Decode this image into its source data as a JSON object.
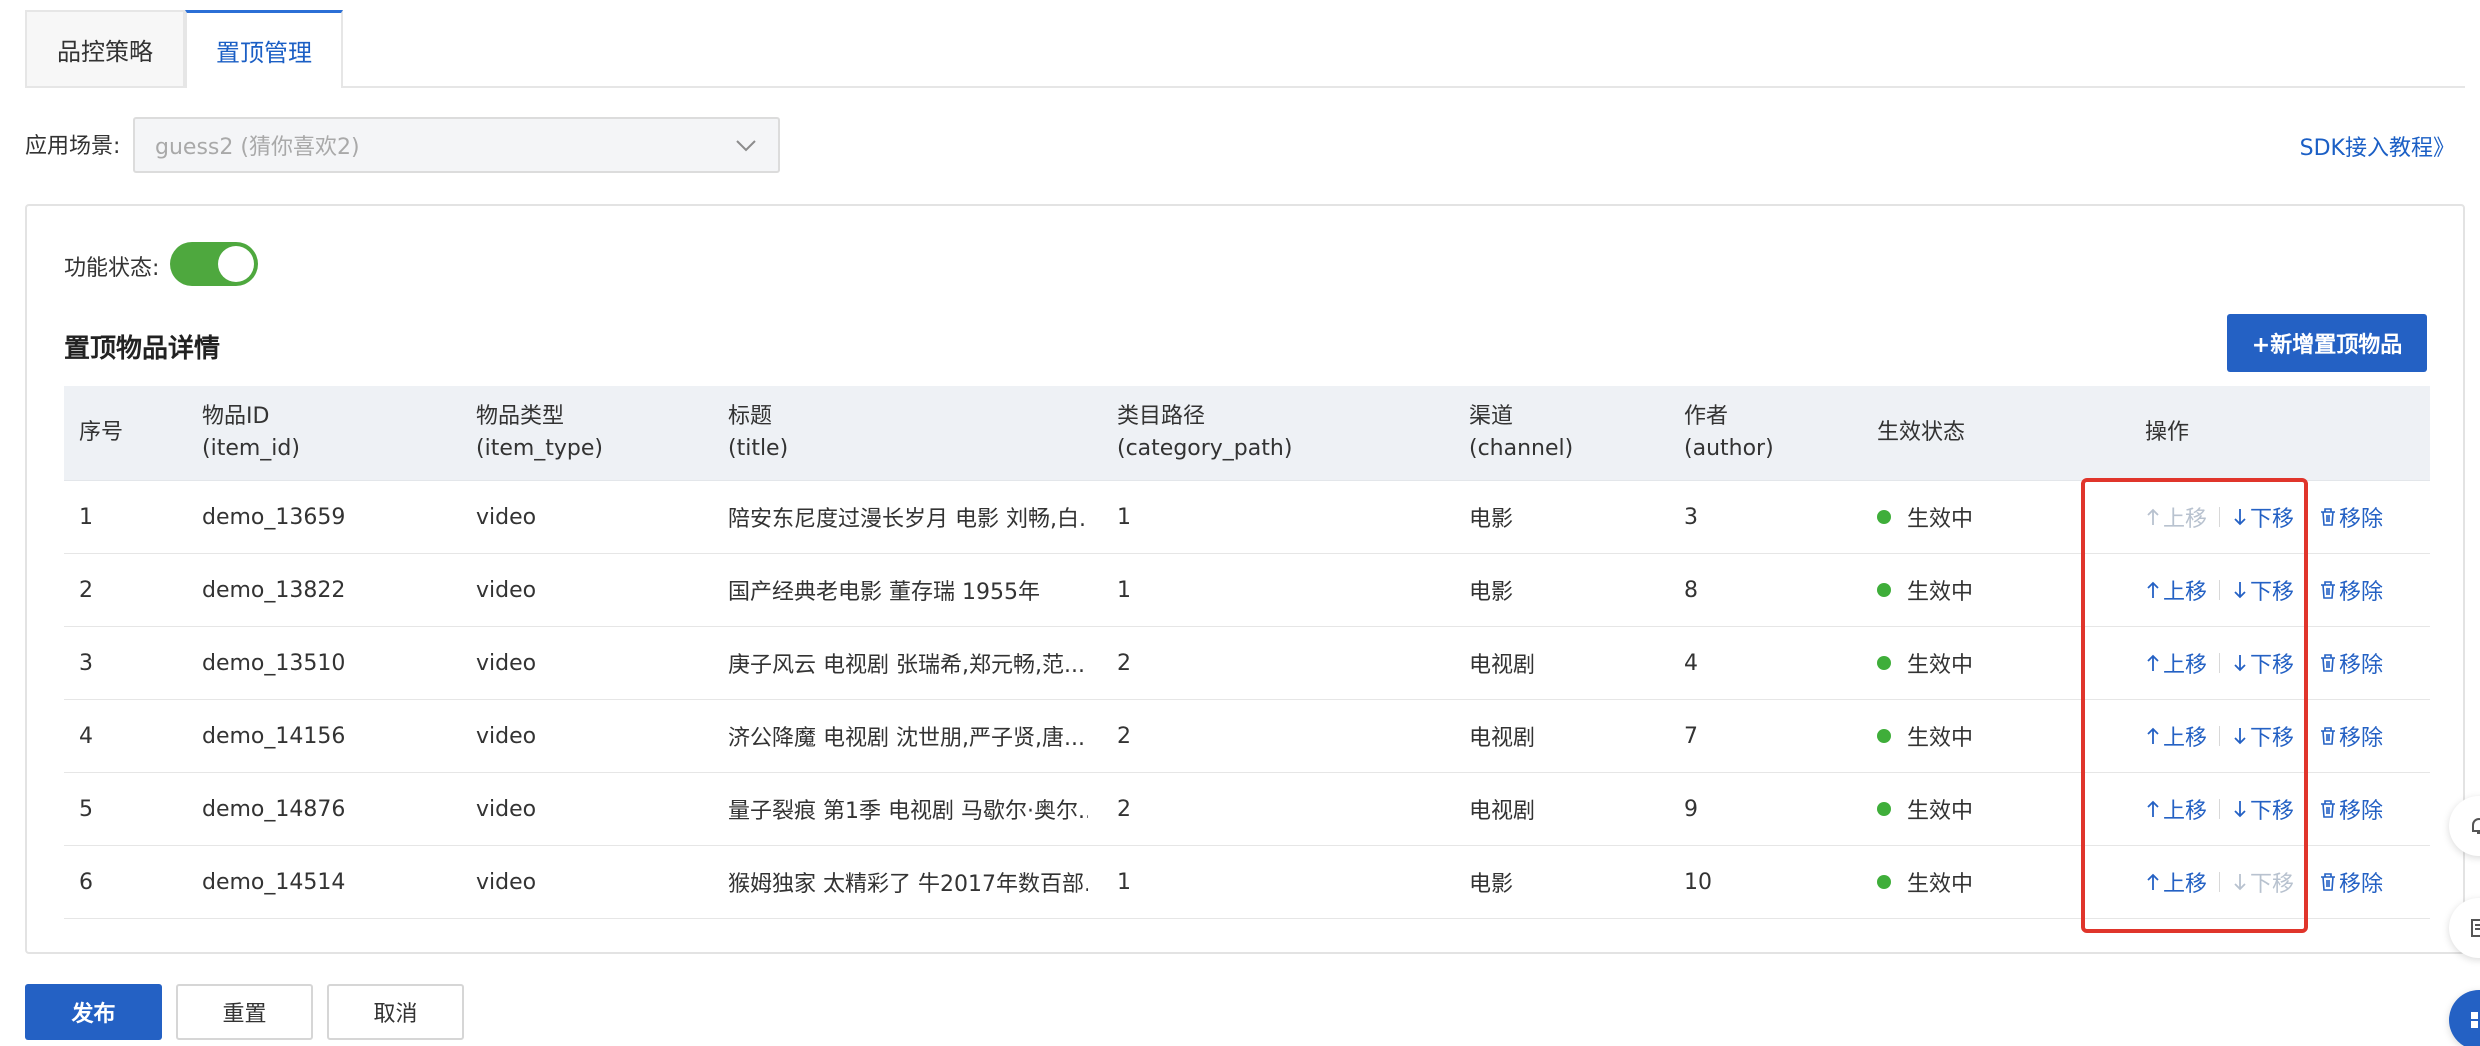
{
  "tabs": [
    {
      "label": "品控策略"
    },
    {
      "label": "置顶管理"
    }
  ],
  "scene": {
    "label": "应用场景:",
    "value": "guess2 (猜你喜欢2)"
  },
  "sdk_link": "SDK接入教程》",
  "feature": {
    "status_label": "功能状态:",
    "enabled": true
  },
  "section_title": "置顶物品详情",
  "add_button": "+新增置顶物品",
  "table": {
    "headers": {
      "seq": "序号",
      "item_id": [
        "物品ID",
        "(item_id)"
      ],
      "item_type": [
        "物品类型",
        "(item_type)"
      ],
      "title": [
        "标题",
        "(title)"
      ],
      "category_path": [
        "类目路径",
        "(category_path)"
      ],
      "channel": [
        "渠道",
        "(channel)"
      ],
      "author": [
        "作者",
        "(author)"
      ],
      "status": "生效状态",
      "ops": "操作"
    },
    "rows": [
      {
        "seq": "1",
        "item_id": "demo_13659",
        "item_type": "video",
        "title": "陪安东尼度过漫长岁月 电影 刘畅,白...",
        "category_path": "1",
        "channel": "电影",
        "author": "3",
        "status": "生效中",
        "up": "上移",
        "down": "下移",
        "remove": "移除",
        "up_disabled": true,
        "down_disabled": false
      },
      {
        "seq": "2",
        "item_id": "demo_13822",
        "item_type": "video",
        "title": "国产经典老电影 董存瑞 1955年",
        "category_path": "1",
        "channel": "电影",
        "author": "8",
        "status": "生效中",
        "up": "上移",
        "down": "下移",
        "remove": "移除",
        "up_disabled": false,
        "down_disabled": false
      },
      {
        "seq": "3",
        "item_id": "demo_13510",
        "item_type": "video",
        "title": "庚子风云 电视剧 张瑞希,郑元畅,范...",
        "category_path": "2",
        "channel": "电视剧",
        "author": "4",
        "status": "生效中",
        "up": "上移",
        "down": "下移",
        "remove": "移除",
        "up_disabled": false,
        "down_disabled": false
      },
      {
        "seq": "4",
        "item_id": "demo_14156",
        "item_type": "video",
        "title": "济公降魔 电视剧 沈世朋,严子贤,唐...",
        "category_path": "2",
        "channel": "电视剧",
        "author": "7",
        "status": "生效中",
        "up": "上移",
        "down": "下移",
        "remove": "移除",
        "up_disabled": false,
        "down_disabled": false
      },
      {
        "seq": "5",
        "item_id": "demo_14876",
        "item_type": "video",
        "title": "量子裂痕 第1季 电视剧 马歇尔·奥尔...",
        "category_path": "2",
        "channel": "电视剧",
        "author": "9",
        "status": "生效中",
        "up": "上移",
        "down": "下移",
        "remove": "移除",
        "up_disabled": false,
        "down_disabled": false
      },
      {
        "seq": "6",
        "item_id": "demo_14514",
        "item_type": "video",
        "title": "猴姆独家 太精彩了 牛2017年数百部...",
        "category_path": "1",
        "channel": "电影",
        "author": "10",
        "status": "生效中",
        "up": "上移",
        "down": "下移",
        "remove": "移除",
        "up_disabled": false,
        "down_disabled": true
      }
    ]
  },
  "footer": {
    "publish": "发布",
    "reset": "重置",
    "cancel": "取消"
  },
  "colors": {
    "primary": "#2461c4",
    "active_tab": "#1b5fc5",
    "switch_on": "#4ea83e",
    "status_dot": "#3fae3a",
    "disabled": "#b8c2cf",
    "highlight": "#e0352b"
  },
  "icons": {
    "scene_chevron": "chevron-down-icon",
    "up": "arrow-up-icon",
    "down": "arrow-down-icon",
    "remove": "trash-icon"
  }
}
